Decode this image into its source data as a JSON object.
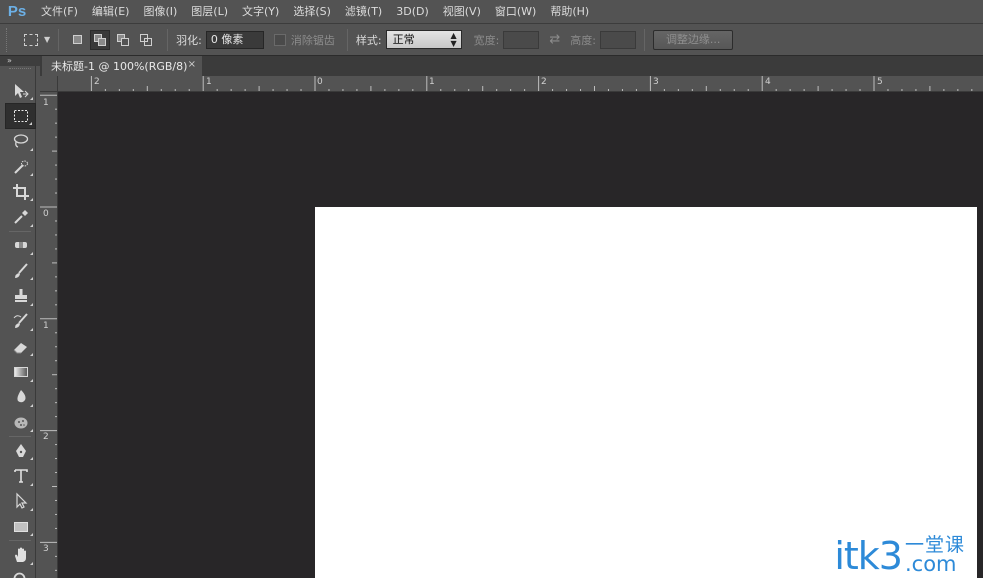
{
  "app": {
    "logo": "Ps"
  },
  "menu": {
    "items": [
      "文件(F)",
      "编辑(E)",
      "图像(I)",
      "图层(L)",
      "文字(Y)",
      "选择(S)",
      "滤镜(T)",
      "3D(D)",
      "视图(V)",
      "窗口(W)",
      "帮助(H)"
    ]
  },
  "options": {
    "feather_label": "羽化:",
    "feather_value": "0 像素",
    "antialias_label": "消除锯齿",
    "style_label": "样式:",
    "style_value": "正常",
    "width_label": "宽度:",
    "height_label": "高度:",
    "refine_edge_label": "调整边缘..."
  },
  "document": {
    "tab_title": "未标题-1 @ 100%(RGB/8)",
    "close_glyph": "×"
  },
  "rulers": {
    "horizontal": [
      "2",
      "1",
      "0",
      "1",
      "2",
      "3",
      "4",
      "5"
    ],
    "vertical": [
      "1",
      "0",
      "1",
      "2",
      "3"
    ]
  },
  "watermark": {
    "main": "itk3",
    "chinese": "一堂课",
    "domain": ".com"
  },
  "colors": {
    "logo": "#6cb0e6",
    "workspace": "#282628",
    "canvas": "#ffffff",
    "watermark": "#2d8ad8"
  }
}
